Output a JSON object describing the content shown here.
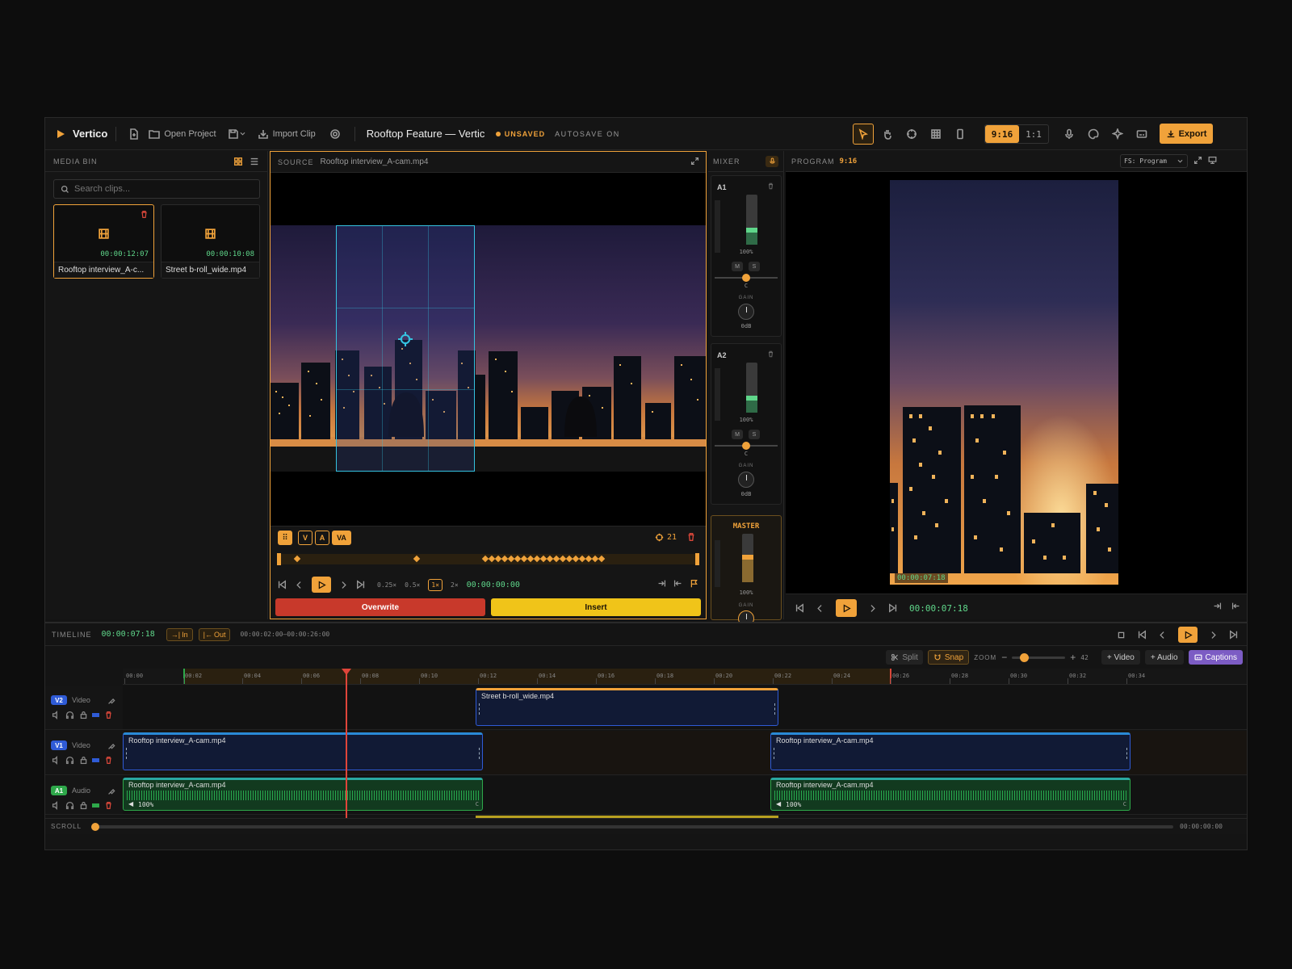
{
  "app": {
    "name": "Vertico",
    "project_title": "Rooftop Feature — Vertical",
    "status": "UNSAVED",
    "autosave": "AUTOSAVE ON"
  },
  "toolbar": {
    "open_project": "Open Project",
    "import_clip": "Import Clip",
    "aspect_916": "9:16",
    "aspect_11": "1:1",
    "export": "Export"
  },
  "media_bin": {
    "title": "MEDIA BIN",
    "search_placeholder": "Search clips...",
    "clips": [
      {
        "name": "Rooftop interview_A-c...",
        "duration": "00:00:12:07"
      },
      {
        "name": "Street b-roll_wide.mp4",
        "duration": "00:00:10:08"
      }
    ]
  },
  "source": {
    "label": "SOURCE",
    "file": "Rooftop interview_A-cam.mp4",
    "mode_v": "V",
    "mode_a": "A",
    "mode_va": "VA",
    "keyframe_count": "21",
    "speeds": [
      "0.25×",
      "0.5×",
      "1×",
      "2×"
    ],
    "timecode": "00:00:00:00",
    "overwrite": "Overwrite",
    "insert": "Insert"
  },
  "mixer": {
    "title": "MIXER",
    "channels": [
      {
        "name": "A1",
        "level": "100%",
        "mute": "M",
        "solo": "S",
        "pan": "C",
        "gain_label": "GAIN",
        "gain": "0dB",
        "fader": 0.72
      },
      {
        "name": "A2",
        "level": "100%",
        "mute": "M",
        "solo": "S",
        "pan": "C",
        "gain_label": "GAIN",
        "gain": "0dB",
        "fader": 0.72
      }
    ],
    "master": {
      "name": "MASTER",
      "level": "100%",
      "gain_label": "GAIN"
    }
  },
  "program": {
    "label": "PROGRAM",
    "aspect": "9:16",
    "select": "FS: Program",
    "overlay_timecode": "00:00:07:18",
    "timecode": "00:00:07:18"
  },
  "timeline": {
    "label": "TIMELINE",
    "timecode": "00:00:07:18",
    "in_label": "In",
    "out_label": "Out",
    "range": "00:00:02:00–00:00:26:00",
    "split": "Split",
    "snap": "Snap",
    "zoom_label": "ZOOM",
    "zoom_value": "42",
    "add_video": "+ Video",
    "add_audio": "+ Audio",
    "captions": "Captions",
    "ruler": [
      "00:00",
      "00:02",
      "00:04",
      "00:06",
      "00:08",
      "00:10",
      "00:12",
      "00:14",
      "00:16",
      "00:18",
      "00:20",
      "00:22",
      "00:24",
      "00:26",
      "00:28",
      "00:30",
      "00:32",
      "00:34"
    ],
    "tracks": [
      {
        "id": "V2",
        "type": "Video"
      },
      {
        "id": "V1",
        "type": "Video"
      },
      {
        "id": "A1",
        "type": "Audio"
      }
    ],
    "clips": {
      "v2": "Street b-roll_wide.mp4",
      "v1a": "Rooftop interview_A-cam.mp4",
      "v1b": "Rooftop interview_A-cam.mp4",
      "a1a": "Rooftop interview_A-cam.mp4",
      "a1b": "Rooftop interview_A-cam.mp4",
      "a1_level": "100%",
      "a1_pan": "C"
    },
    "scroll_label": "SCROLL",
    "scroll_time": "00:00:00:00"
  },
  "colors": {
    "accent": "#f0a23a",
    "overwrite": "#c8392b",
    "insert": "#f0c419",
    "v2": "#2f5bd6",
    "a1": "#2ea84a",
    "captions": "#7c5cc4"
  }
}
